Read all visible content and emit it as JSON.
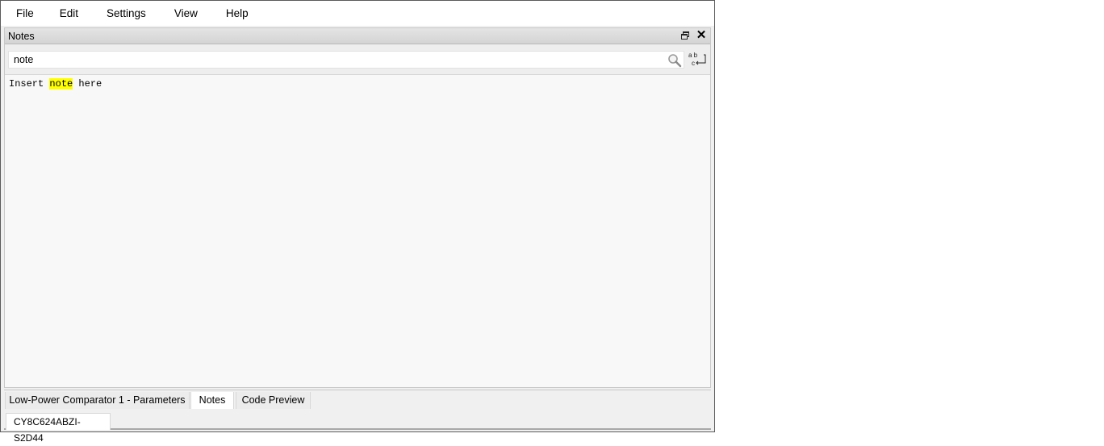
{
  "menu": {
    "items": [
      {
        "label": "File"
      },
      {
        "label": "Edit"
      },
      {
        "label": "Settings"
      },
      {
        "label": "View"
      },
      {
        "label": "Help"
      }
    ]
  },
  "panel": {
    "title": "Notes",
    "float_icon": "float-window-icon",
    "close_glyph": "✕",
    "search": {
      "value": "note",
      "icon": "search-icon",
      "wrap_icon": "word-wrap-icon"
    },
    "editor": {
      "before": "Insert ",
      "highlight": "note",
      "after": " here",
      "highlight_color": "#ffff00"
    }
  },
  "tabs": [
    {
      "label": "Low-Power Comparator 1 - Parameters",
      "active": false
    },
    {
      "label": "Notes",
      "active": true
    },
    {
      "label": "Code Preview",
      "active": false
    }
  ],
  "status": {
    "device": "CY8C624ABZI-S2D44"
  }
}
